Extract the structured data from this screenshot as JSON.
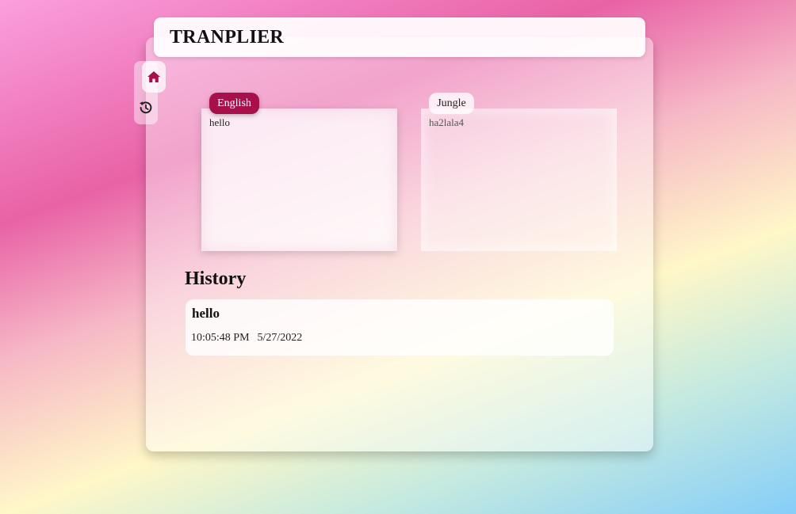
{
  "app": {
    "title": "TRANPLIER"
  },
  "nav": {
    "items": [
      {
        "name": "home",
        "icon": "home-icon",
        "active": true,
        "color": "#a8104c"
      },
      {
        "name": "history",
        "icon": "history-icon",
        "active": false,
        "color": "#222222"
      }
    ]
  },
  "translator": {
    "source": {
      "language": "English",
      "text": "hello"
    },
    "target": {
      "language": "Jungle",
      "text": "ha2lala4"
    }
  },
  "history": {
    "heading": "History",
    "entries": [
      {
        "text": "hello",
        "time": "10:05:48 PM",
        "date": "5/27/2022"
      }
    ]
  },
  "colors": {
    "accent": "#a8104c"
  }
}
